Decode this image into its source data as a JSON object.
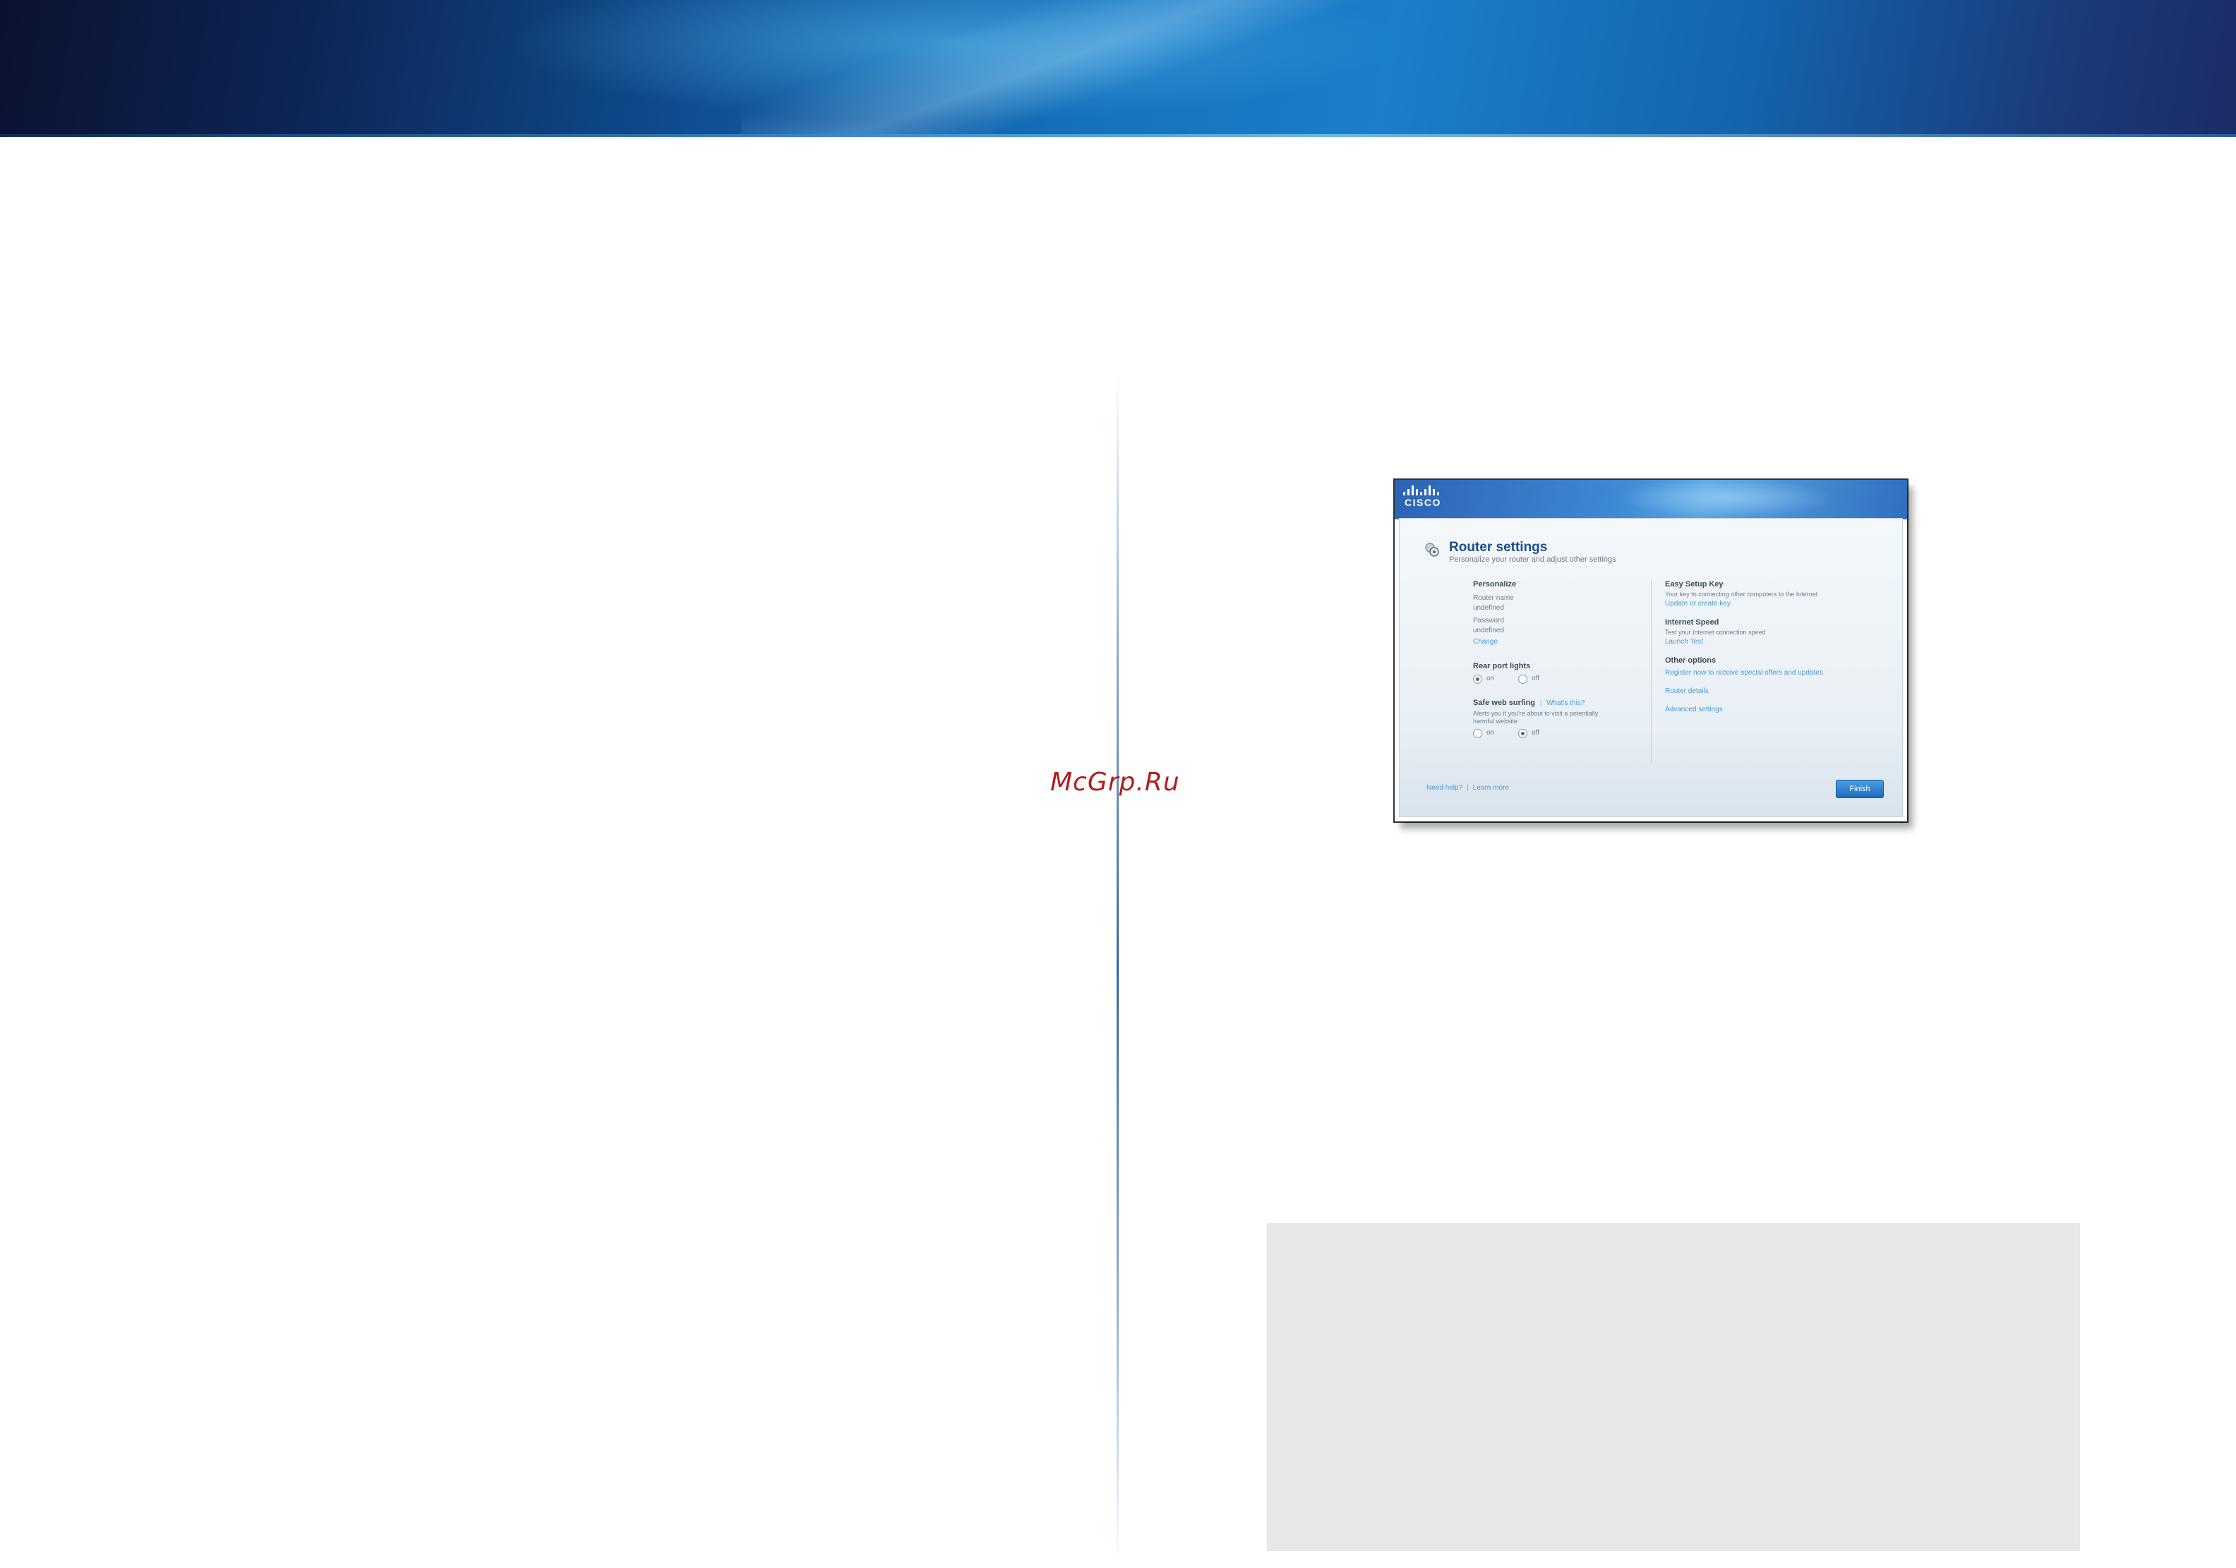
{
  "watermark": "McGrp.Ru",
  "router_screen": {
    "brand": "CISCO",
    "title": "Router settings",
    "subtitle": "Personalize your router and adjust other settings",
    "personalize": {
      "heading": "Personalize",
      "router_name_label": "Router name",
      "router_name_value": "undefined",
      "password_label": "Password",
      "password_value": "undefined",
      "change_link": "Change"
    },
    "rear_port_lights": {
      "heading": "Rear port lights",
      "option_on": "on",
      "option_off": "off",
      "selected": "on"
    },
    "safe_web_surfing": {
      "heading": "Safe web surfing",
      "help_link": "What's this?",
      "description": "Alerts you if you're about to visit a potentially harmful website",
      "option_on": "on",
      "option_off": "off",
      "selected": "off"
    },
    "easy_setup_key": {
      "heading": "Easy Setup Key",
      "description": "Your key to connecting other computers to the Internet",
      "link": "Update or create key"
    },
    "internet_speed": {
      "heading": "Internet Speed",
      "description": "Test your Internet connection speed",
      "link": "Launch Test"
    },
    "other_options": {
      "heading": "Other options",
      "links": [
        "Register now to receive special offers and updates",
        "Router details",
        "Advanced settings"
      ]
    },
    "footer": {
      "need_help": "Need help?",
      "learn_more": "Learn more"
    },
    "finish_button": "Finish"
  }
}
